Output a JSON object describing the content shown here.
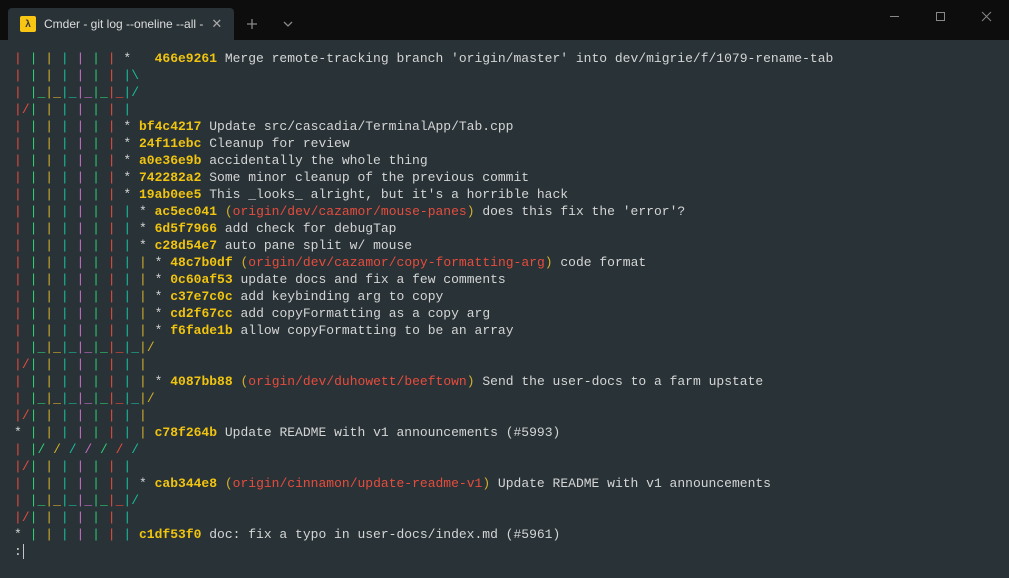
{
  "tab": {
    "icon_text": "λ",
    "title": "Cmder - git  log --oneline --all -"
  },
  "graph": [
    {
      "g": "| | | | | | | *   ",
      "h": "466e9261",
      "msg": " Merge remote-tracking branch 'origin/master' into dev/migrie/f/1079-rename-tab"
    },
    {
      "g": "| | | | | | | |\\"
    },
    {
      "g": "| |_|_|_|_|_|_|/"
    },
    {
      "g": "|/| | | | | | |"
    },
    {
      "g": "| | | | | | | * ",
      "h": "bf4c4217",
      "msg": " Update src/cascadia/TerminalApp/Tab.cpp"
    },
    {
      "g": "| | | | | | | * ",
      "h": "24f11ebc",
      "msg": " Cleanup for review"
    },
    {
      "g": "| | | | | | | * ",
      "h": "a0e36e9b",
      "msg": " accidentally the whole thing"
    },
    {
      "g": "| | | | | | | * ",
      "h": "742282a2",
      "msg": " Some minor cleanup of the previous commit"
    },
    {
      "g": "| | | | | | | * ",
      "h": "19ab0ee5",
      "msg": " This _looks_ alright, but it's a horrible hack"
    },
    {
      "g": "| | | | | | | | * ",
      "h": "ac5ec041",
      "msg": " does this fix the 'error'?",
      "ref": "origin/dev/cazamor/mouse-panes"
    },
    {
      "g": "| | | | | | | | * ",
      "h": "6d5f7966",
      "msg": " add check for debugTap"
    },
    {
      "g": "| | | | | | | | * ",
      "h": "c28d54e7",
      "msg": " auto pane split w/ mouse"
    },
    {
      "g": "| | | | | | | | | * ",
      "h": "48c7b0df",
      "msg": " code format",
      "ref": "origin/dev/cazamor/copy-formatting-arg"
    },
    {
      "g": "| | | | | | | | | * ",
      "h": "0c60af53",
      "msg": " update docs and fix a few comments"
    },
    {
      "g": "| | | | | | | | | * ",
      "h": "c37e7c0c",
      "msg": " add keybinding arg to copy"
    },
    {
      "g": "| | | | | | | | | * ",
      "h": "cd2f67cc",
      "msg": " add copyFormatting as a copy arg"
    },
    {
      "g": "| | | | | | | | | * ",
      "h": "f6fade1b",
      "msg": " allow copyFormatting to be an array"
    },
    {
      "g": "| |_|_|_|_|_|_|_|/"
    },
    {
      "g": "|/| | | | | | | |"
    },
    {
      "g": "| | | | | | | | | * ",
      "h": "4087bb88",
      "msg": " Send the user-docs to a farm upstate",
      "ref": "origin/dev/duhowett/beeftown"
    },
    {
      "g": "| |_|_|_|_|_|_|_|/"
    },
    {
      "g": "|/| | | | | | | |"
    },
    {
      "g": "* | | | | | | | | ",
      "h": "c78f264b",
      "msg": " Update README with v1 announcements (#5993)"
    },
    {
      "g": "| |/ / / / / / /"
    },
    {
      "g": "|/| | | | | | |"
    },
    {
      "g": "| | | | | | | | * ",
      "h": "cab344e8",
      "msg": " Update README with v1 announcements",
      "ref": "origin/cinnamon/update-readme-v1"
    },
    {
      "g": "| |_|_|_|_|_|_|/"
    },
    {
      "g": "|/| | | | | | |"
    },
    {
      "g": "* | | | | | | | ",
      "h": "c1df53f0",
      "msg": " doc: fix a typo in user-docs/index.md (#5961)"
    }
  ],
  "prompt": ":"
}
